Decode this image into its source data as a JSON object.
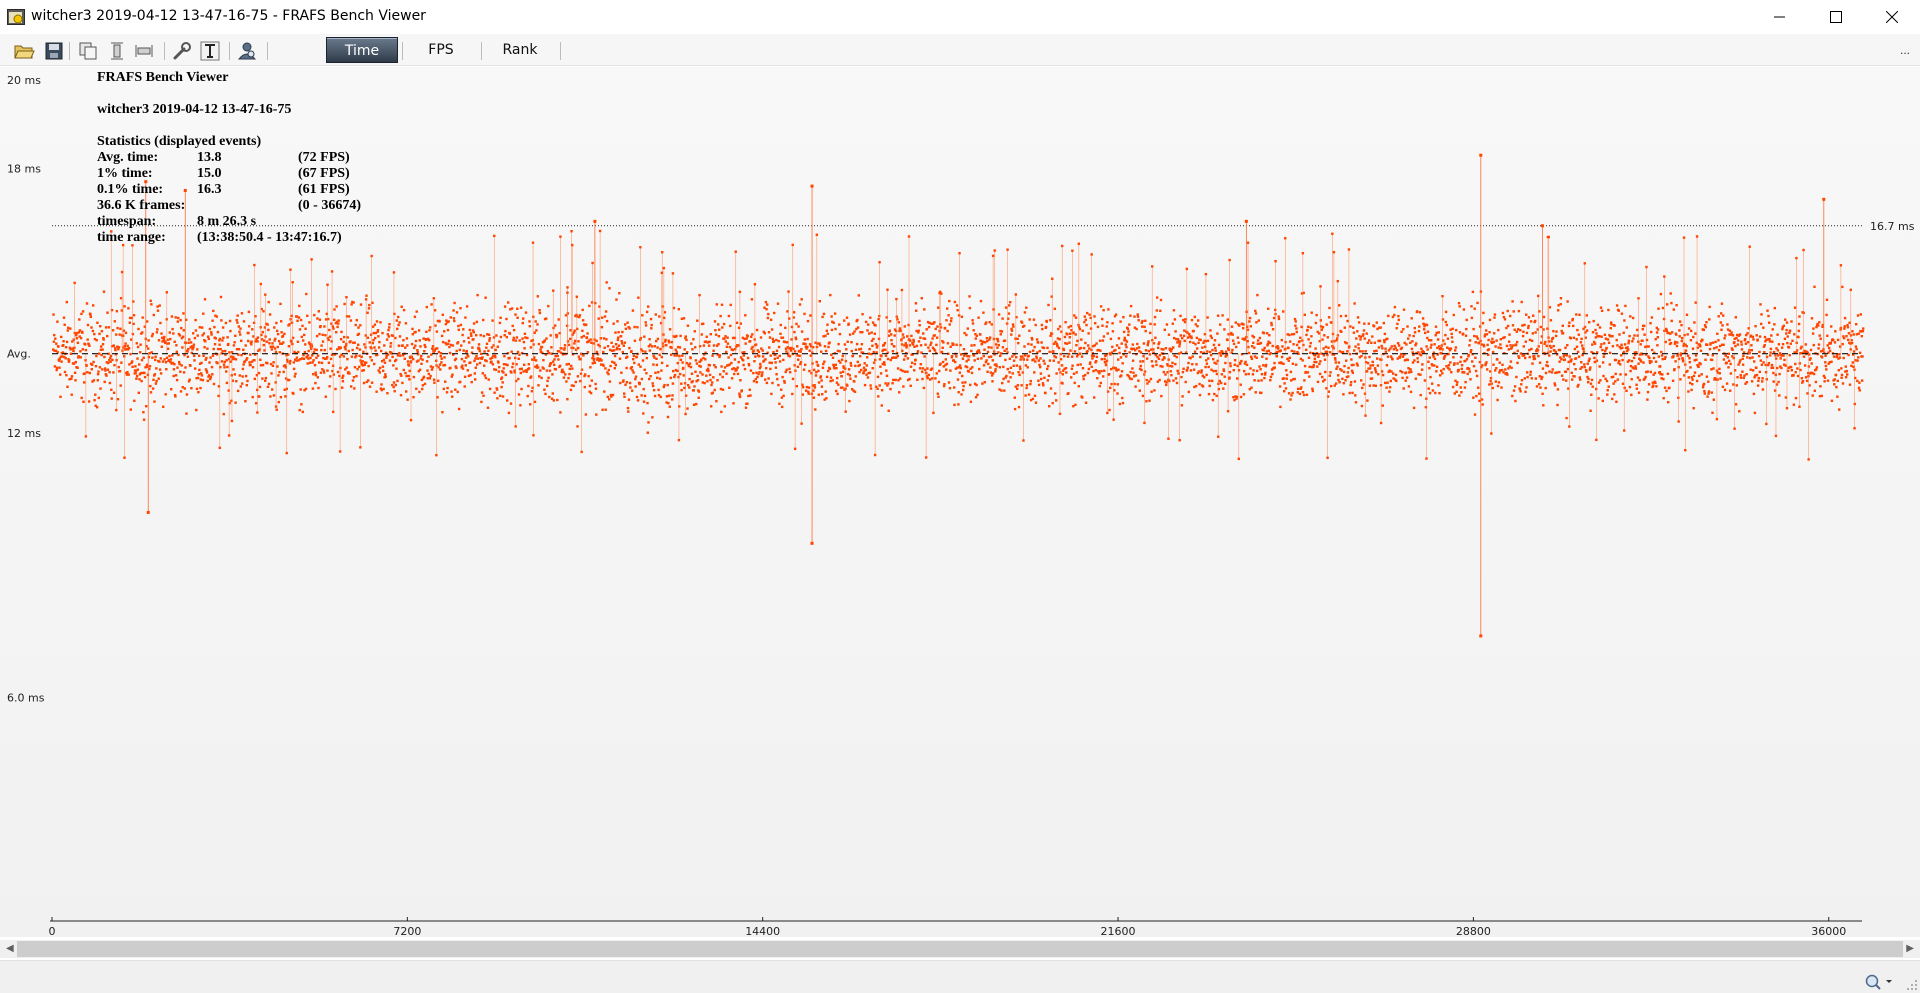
{
  "window": {
    "title": "witcher3 2019-04-12 13-47-16-75 - FRAFS Bench Viewer"
  },
  "toolbar": {
    "icons": [
      "open-folder-icon",
      "save-icon",
      "copy-icon",
      "fit-vertical-icon",
      "fit-horizontal-icon",
      "wrench-icon",
      "text-icon",
      "user-search-icon"
    ],
    "tabs": [
      {
        "label": "Time",
        "active": true
      },
      {
        "label": "FPS",
        "active": false
      },
      {
        "label": "Rank",
        "active": false
      }
    ],
    "more_label": "..."
  },
  "stats": {
    "app_name": "FRAFS Bench Viewer",
    "session": "witcher3 2019-04-12 13-47-16-75",
    "heading": "Statistics (displayed events)",
    "rows": [
      [
        "Avg. time:",
        "13.8",
        "(72 FPS)"
      ],
      [
        "1% time:",
        "15.0",
        "(67 FPS)"
      ],
      [
        "0.1% time:",
        "16.3",
        "(61 FPS)"
      ],
      [
        "36.6 K frames:",
        "",
        "(0 - 36674)"
      ],
      [
        "timespan:",
        "8 m 26.3 s",
        ""
      ],
      [
        "time range:",
        "(13:38:50.4 - 13:47:16.7)",
        ""
      ]
    ]
  },
  "chart_data": {
    "type": "scatter",
    "series_color": "#ff4500",
    "y_unit": "ms",
    "y_ticks": [
      {
        "value": 20,
        "label": "20 ms"
      },
      {
        "value": 18,
        "label": "18 ms"
      },
      {
        "value": 13.8,
        "label": "Avg."
      },
      {
        "value": 12,
        "label": "12 ms"
      },
      {
        "value": 6,
        "label": "6.0 ms"
      }
    ],
    "ylim": [
      0.8,
      20.3
    ],
    "x_ticks": [
      0,
      7200,
      14400,
      21600,
      28800,
      36000
    ],
    "xlim": [
      0,
      36674
    ],
    "reference_line": {
      "value": 16.7,
      "label": "16.7 ms",
      "style": "dotted"
    },
    "average_line": {
      "value": 13.8,
      "style": "dashed"
    },
    "frame_count": 36674,
    "baseline_ms": 13.8,
    "spikes": [
      {
        "x": 1900,
        "y": 17.7
      },
      {
        "x": 1950,
        "y": 10.2
      },
      {
        "x": 2700,
        "y": 17.5
      },
      {
        "x": 11000,
        "y": 16.8
      },
      {
        "x": 15400,
        "y": 17.6
      },
      {
        "x": 15400,
        "y": 9.5
      },
      {
        "x": 24200,
        "y": 16.8
      },
      {
        "x": 28950,
        "y": 18.3
      },
      {
        "x": 28950,
        "y": 7.4
      },
      {
        "x": 30200,
        "y": 16.7
      },
      {
        "x": 35900,
        "y": 17.3
      }
    ]
  },
  "status": {
    "zoom_icon": "zoom-icon"
  }
}
